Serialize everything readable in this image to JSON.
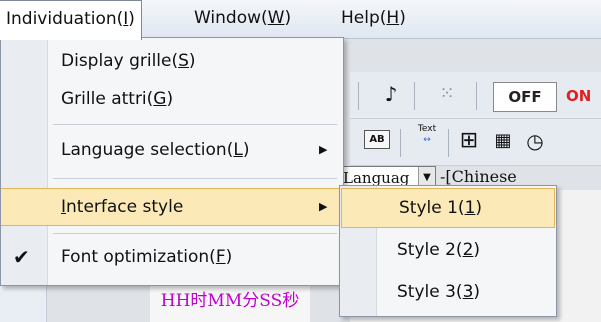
{
  "menubar": {
    "items": [
      {
        "label": "Individuation(",
        "key": "I",
        "suffix": ")"
      },
      {
        "label": "Window(",
        "key": "W",
        "suffix": ")"
      },
      {
        "label": "Help(",
        "key": "H",
        "suffix": ")"
      }
    ]
  },
  "dropdown": {
    "items": [
      {
        "label": "Display grille(",
        "key": "S",
        "suffix": ")"
      },
      {
        "label": "Grille attri(",
        "key": "G",
        "suffix": ")"
      },
      {
        "label": "Language selection(",
        "key": "L",
        "suffix": ")",
        "arrow": "▶"
      },
      {
        "key": "I",
        "label": "nterface style",
        "arrow": "▶"
      },
      {
        "label": "Font optimization(",
        "key": "F",
        "suffix": ")",
        "check": "✔"
      }
    ]
  },
  "submenu": {
    "items": [
      {
        "label": "Style 1(",
        "key": "1",
        "suffix": ")"
      },
      {
        "label": "Style 2(",
        "key": "2",
        "suffix": ")"
      },
      {
        "label": "Style 3(",
        "key": "3",
        "suffix": ")"
      }
    ]
  },
  "background": {
    "off_label": "OFF",
    "on_label": "ON",
    "ab_label": "AB",
    "text_label": "Text",
    "lang_select_value": "Languag",
    "lang_select_arrow": "▼",
    "lang_text": "-[Chinese",
    "time_format": "HH时MM分SS秒"
  },
  "icons": {
    "music": "music-note-icon",
    "grid_dots": "grid-dots-icon",
    "table": "table-icon",
    "calendar": "calendar-icon",
    "clock": "clock-icon"
  },
  "colors": {
    "highlight": "#fbe9b8",
    "highlight_border": "#e3b55a",
    "on_red": "#e02020",
    "time_magenta": "#c000d0"
  }
}
